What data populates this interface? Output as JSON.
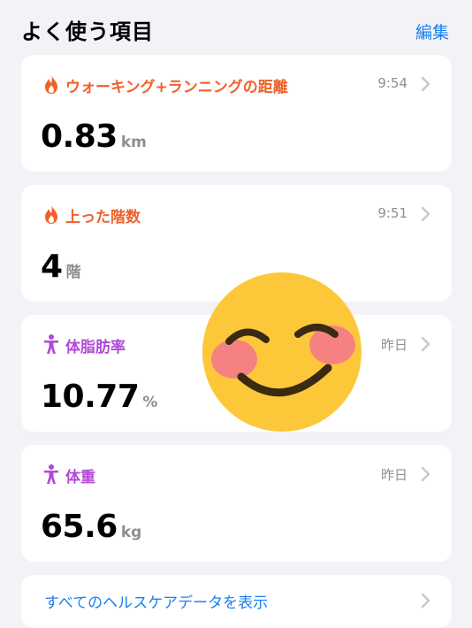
{
  "header": {
    "title": "よく使う項目",
    "edit_label": "編集"
  },
  "cards": [
    {
      "category": "ウォーキング+ランニングの距離",
      "time": "9:54",
      "value": "0.83",
      "unit": "km",
      "icon": "flame-icon",
      "color": "#f0612a"
    },
    {
      "category": "上った階数",
      "time": "9:51",
      "value": "4",
      "unit": "階",
      "icon": "flame-icon",
      "color": "#f0612a"
    },
    {
      "category": "体脂肪率",
      "time": "昨日",
      "value": "10.77",
      "unit": "%",
      "icon": "person-figure-icon",
      "color": "#b24ad6"
    },
    {
      "category": "体重",
      "time": "昨日",
      "value": "65.6",
      "unit": "kg",
      "icon": "person-figure-icon",
      "color": "#b24ad6"
    }
  ],
  "show_all_label": "すべてのヘルスケアデータを表示",
  "overlay": {
    "icon": "smiling-face-emoji"
  },
  "colors": {
    "accent_blue": "#1a7ff0",
    "activity_orange": "#f0612a",
    "body_purple": "#b24ad6",
    "background": "#f2f2f7"
  }
}
